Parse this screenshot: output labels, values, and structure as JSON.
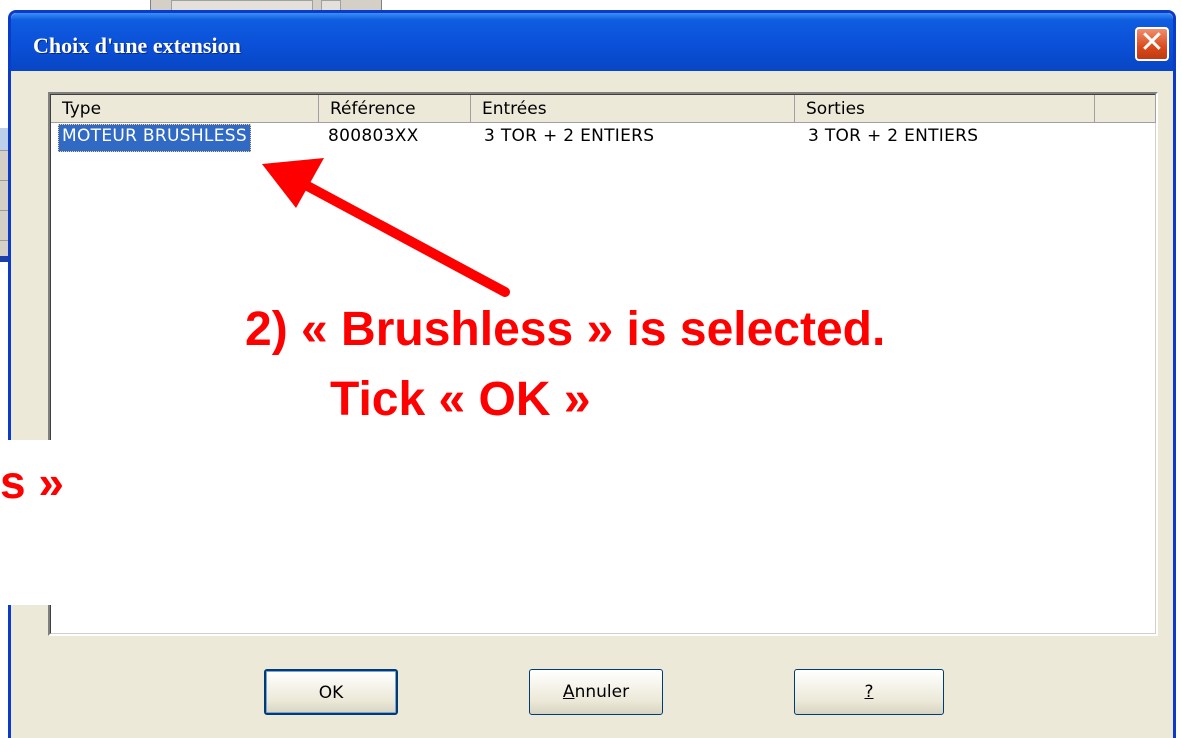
{
  "dialog": {
    "title": "Choix d'une extension",
    "close_glyph": "✕"
  },
  "listview": {
    "columns": [
      "Type",
      "Référence",
      "Entrées",
      "Sorties"
    ],
    "rows": [
      {
        "type": "MOTEUR BRUSHLESS",
        "reference": "800803XX",
        "entrees": "3 TOR + 2 ENTIERS",
        "sorties": "3 TOR + 2 ENTIERS",
        "selected": true
      }
    ]
  },
  "buttons": {
    "ok": "OK",
    "annuler_rest": "nnuler",
    "annuler_mnemonic": "A",
    "help": "?"
  },
  "annotation": {
    "line1": "2) « Brushless » is selected.",
    "line2": "Tick « OK »",
    "partial": "s »",
    "color": "#ff0000"
  },
  "theme": {
    "titlebar": "#0a50d8",
    "dialog_bg": "#ece9d8",
    "selection": "#316ac5"
  }
}
